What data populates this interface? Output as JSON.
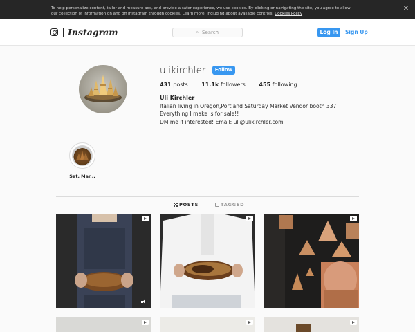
{
  "cookie_banner": {
    "text": "To help personalize content, tailor and measure ads, and provide a safer experience, we use cookies. By clicking or navigating the site, you agree to allow our collection of information on and off Instagram through cookies. Learn more, including about available controls:",
    "link_label": "Cookies Policy",
    "close_label": "✕"
  },
  "header": {
    "logo_text": "Instagram",
    "search_placeholder": "Search",
    "search_icon": "⌕",
    "login_label": "Log In",
    "signup_label": "Sign Up"
  },
  "profile": {
    "username": "ulikirchler",
    "follow_label": "Follow",
    "posts_count": "431",
    "posts_label": "posts",
    "followers_count": "11.1k",
    "followers_label": "followers",
    "following_count": "455",
    "following_label": "following",
    "full_name": "Uli Kirchler",
    "bio_lines": [
      "Italian living in Oregon,Portland Saturday Market Vendor booth 337",
      "Everything I make is for sale!!",
      "DM me if interested! Email: uli@ulikirchler.com"
    ]
  },
  "highlights": [
    {
      "label": "Sat. Mar..."
    }
  ],
  "tabs": [
    {
      "label": "POSTS",
      "active": true,
      "icon": "grid-icon"
    },
    {
      "label": "TAGGED",
      "active": false,
      "icon": "tag-icon"
    }
  ],
  "posts": [
    {
      "kind": "video",
      "description_icon": "video-icon",
      "sound_icon": true
    },
    {
      "kind": "video",
      "description_icon": "video-icon"
    },
    {
      "kind": "video",
      "description_icon": "video-icon"
    },
    {
      "kind": "video",
      "description_icon": "video-icon"
    },
    {
      "kind": "video",
      "description_icon": "video-icon"
    },
    {
      "kind": "video",
      "description_icon": "video-icon"
    }
  ],
  "colors": {
    "accent": "#3897f0",
    "banner_bg": "#262626",
    "page_bg": "#fafafa",
    "text": "#262626",
    "muted": "#999999"
  }
}
